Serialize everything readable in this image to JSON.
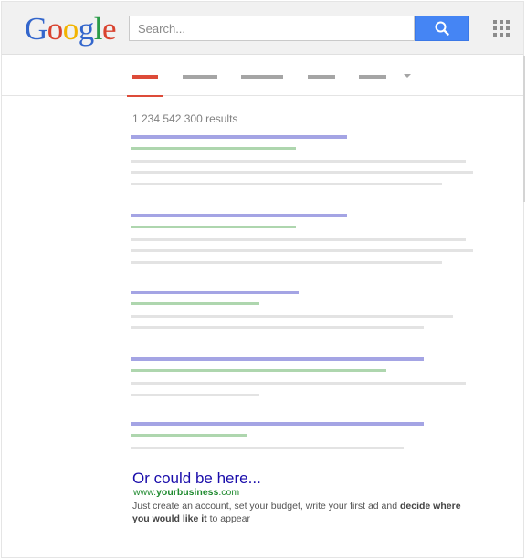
{
  "header": {
    "logo_letters": [
      "G",
      "o",
      "o",
      "g",
      "l",
      "e"
    ],
    "search": {
      "placeholder": "Search...",
      "value": ""
    },
    "search_button_icon": "magnifier-icon",
    "apps_icon": "apps-grid-icon"
  },
  "tabs": {
    "active_color": "#dd4b39",
    "inactive_color": "#a5a5a5",
    "more_icon": "caret-down-icon"
  },
  "results": {
    "count_text": "1 234 542 300 results"
  },
  "ad": {
    "title": "Or could be here...",
    "url_prefix": "www.",
    "url_domain": "yourbusiness",
    "url_suffix": ".com",
    "desc_part1": "Just create an account, set your budget, write your first ad and ",
    "desc_bold1": "decide where you would like it",
    "desc_part2": " to appear"
  },
  "colors": {
    "title_line": "#a4a4e4",
    "url_line": "#aed6ae",
    "snippet_line": "#e3e3e3",
    "search_button": "#4585f4"
  }
}
